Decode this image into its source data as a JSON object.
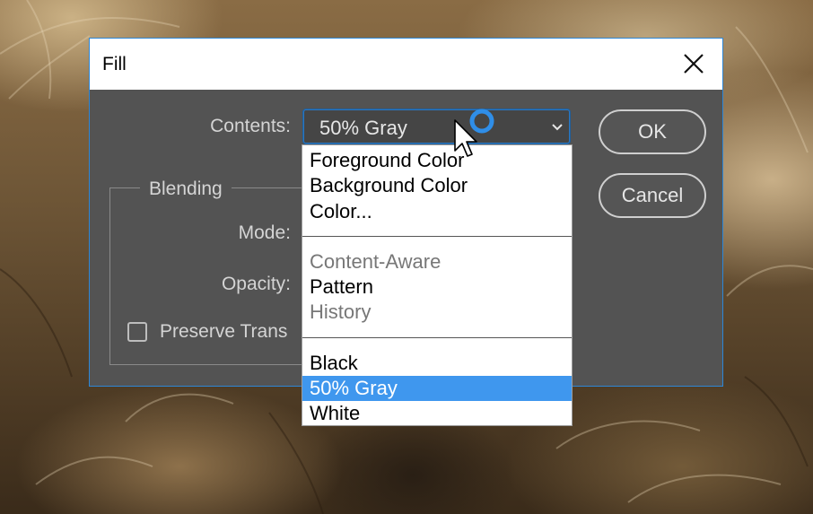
{
  "dialog": {
    "title": "Fill",
    "contents_label": "Contents:",
    "contents_value": "50% Gray",
    "blending_title": "Blending",
    "mode_label": "Mode:",
    "opacity_label": "Opacity:",
    "preserve_label": "Preserve Trans",
    "ok_label": "OK",
    "cancel_label": "Cancel"
  },
  "dropdown": {
    "items": [
      {
        "label": "Foreground Color",
        "state": "enabled"
      },
      {
        "label": "Background Color",
        "state": "enabled"
      },
      {
        "label": "Color...",
        "state": "enabled"
      },
      {
        "label": "Content-Aware",
        "state": "disabled"
      },
      {
        "label": "Pattern",
        "state": "enabled"
      },
      {
        "label": "History",
        "state": "disabled"
      },
      {
        "label": "Black",
        "state": "enabled"
      },
      {
        "label": "50% Gray",
        "state": "selected"
      },
      {
        "label": "White",
        "state": "enabled"
      }
    ]
  },
  "icons": {
    "close": "close-icon",
    "chevron": "chevron-down-icon",
    "cursor": "arrow-cursor-icon",
    "busy": "busy-spinner-icon"
  },
  "colors": {
    "accent": "#3f97ee",
    "dialog_bg": "#535353",
    "border": "#2e87d6"
  }
}
